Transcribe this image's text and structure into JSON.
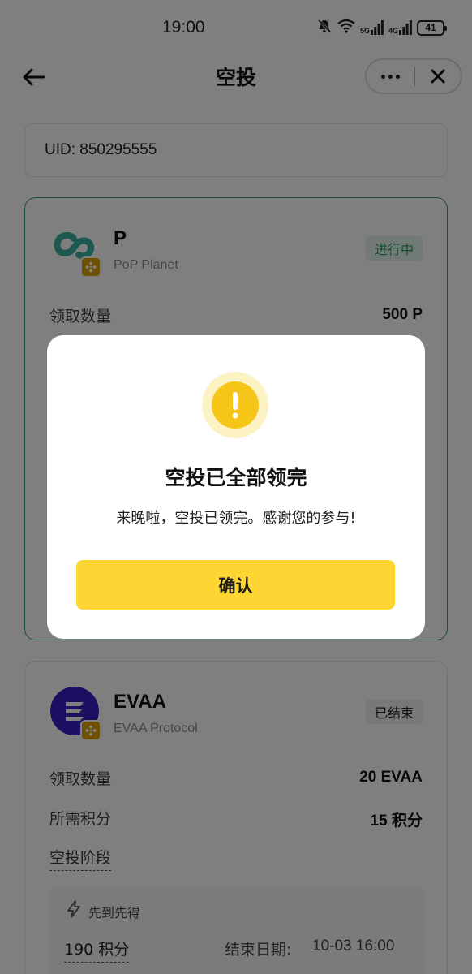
{
  "status_bar": {
    "time": "19:00",
    "network_1": "5G",
    "network_2": "4G",
    "battery": "41",
    "icons": [
      "mute-bell-icon",
      "wifi-icon",
      "signal-5g-icon",
      "signal-4g-icon",
      "battery-icon"
    ]
  },
  "nav": {
    "title": "空投",
    "back_icon": "arrow-left-icon",
    "more_icon": "more-dots-icon",
    "close_icon": "close-icon"
  },
  "uid": {
    "text": "UID: 850295555"
  },
  "airdrops": [
    {
      "symbol": "P",
      "project": "PoP Planet",
      "status": "进行中",
      "status_color": "#2e9a6a",
      "claim_label": "领取数量",
      "claim_value": "500 P"
    },
    {
      "symbol": "EVAA",
      "project": "EVAA Protocol",
      "status": "已结束",
      "claim_label": "领取数量",
      "claim_value": "20 EVAA",
      "points_label": "所需积分",
      "points_value": "15 积分",
      "phase_label": "空投阶段",
      "phase": {
        "title": "先到先得",
        "points": "190 积分",
        "end_label": "结束日期:",
        "end_value": "10-03 16:00"
      }
    }
  ],
  "modal": {
    "icon": "warning-icon",
    "title": "空投已全部领完",
    "message": "来晚啦，空投已领完。感谢您的参与!",
    "confirm_label": "确认",
    "accent": "#fdd633"
  }
}
